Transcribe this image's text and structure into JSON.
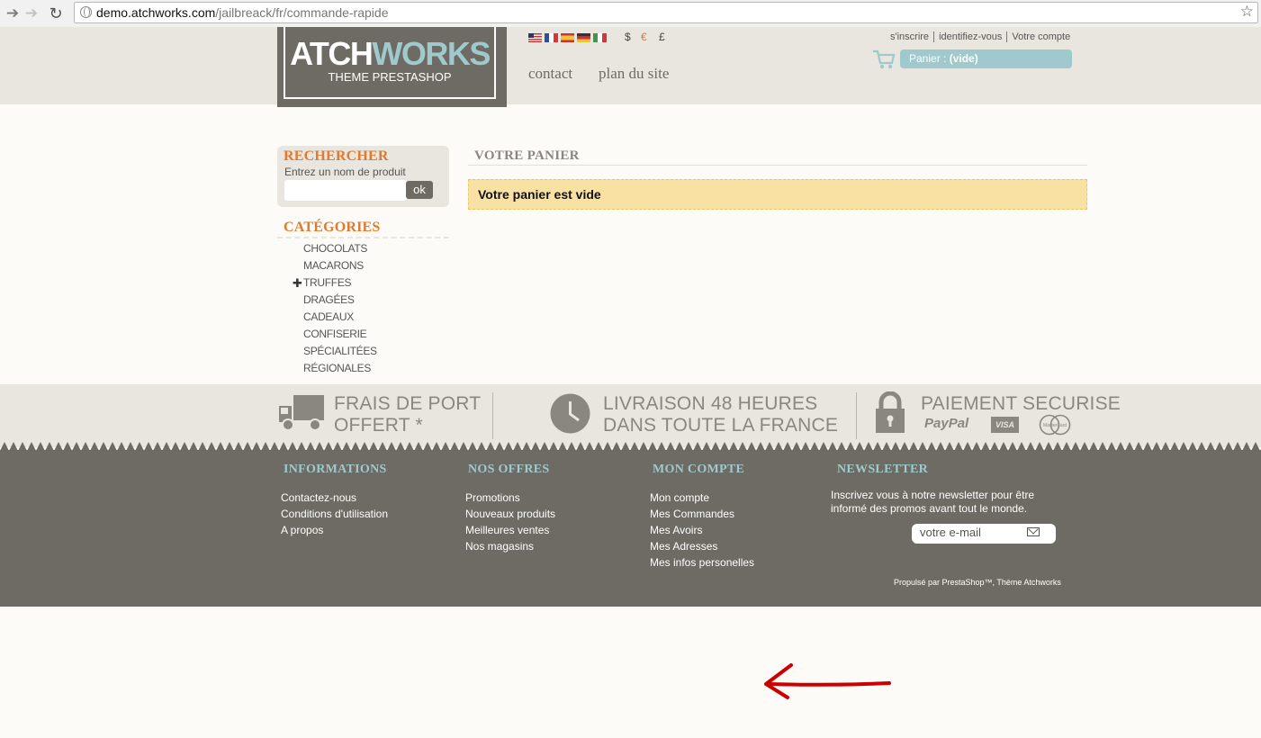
{
  "browser": {
    "url_domain": "demo.atchworks.com",
    "url_path": "/jailbreack/fr/commande-rapide"
  },
  "header": {
    "logo_main_a": "ATCH",
    "logo_main_b": "WORKS",
    "logo_sub": "THEME PRESTASHOP",
    "currencies": [
      "$",
      "€",
      "£"
    ],
    "nav": [
      "contact",
      "plan du site"
    ],
    "user_links": [
      "s'inscrire",
      "identifiez-vous",
      "Votre compte"
    ],
    "cart_label": "Panier :",
    "cart_value": "(vide)"
  },
  "sidebar": {
    "search_title": "RECHERCHER",
    "search_hint": "Entrez un nom de produit",
    "search_placeholder": "",
    "search_button": "ok",
    "categories_title": "CATÉGORIES",
    "categories": [
      "CHOCOLATS",
      "MACARONS",
      "TRUFFES",
      "DRAGÉES",
      "CADEAUX",
      "CONFISERIE",
      "SPÉCIALITÉES",
      "RÉGIONALES"
    ]
  },
  "main": {
    "cart_title": "VOTRE PANIER",
    "empty_message": "Votre panier est vide"
  },
  "reassurance": {
    "shipping_l1": "FRAIS DE PORT",
    "shipping_l2": "OFFERT *",
    "delivery_l1": "LIVRAISON 48 HEURES",
    "delivery_l2": "DANS TOUTE LA FRANCE",
    "payment_l1": "PAIEMENT SECURISE",
    "paypal": "PayPal",
    "visa": "VISA",
    "mastercard": "MasterCard"
  },
  "footer": {
    "informations": {
      "title": "INFORMATIONS",
      "links": [
        "Contactez-nous",
        "Conditions d'utilisation",
        "A propos"
      ]
    },
    "offres": {
      "title": "NOS OFFRES",
      "links": [
        "Promotions",
        "Nouveaux produits",
        "Meilleures ventes",
        "Nos magasins"
      ]
    },
    "compte": {
      "title": "MON COMPTE",
      "links": [
        "Mon compte",
        "Mes Commandes",
        "Mes Avoirs",
        "Mes Adresses",
        "Mes infos personelles"
      ]
    },
    "newsletter": {
      "title": "NEWSLETTER",
      "text": "Inscrivez vous à notre newsletter pour être informé des promos avant tout le monde.",
      "input_value": "votre e-mail"
    },
    "powered": "Propulsé par PrestaShop™, Thème Atchworks"
  },
  "colors": {
    "brand_dark": "#6d6b64",
    "brand_light": "#e9e6df",
    "accent_orange": "#e07a2e",
    "accent_teal": "#9fc9cc",
    "alert_bg": "#f8e1a2",
    "annotation_arrow": "#cc0000"
  }
}
